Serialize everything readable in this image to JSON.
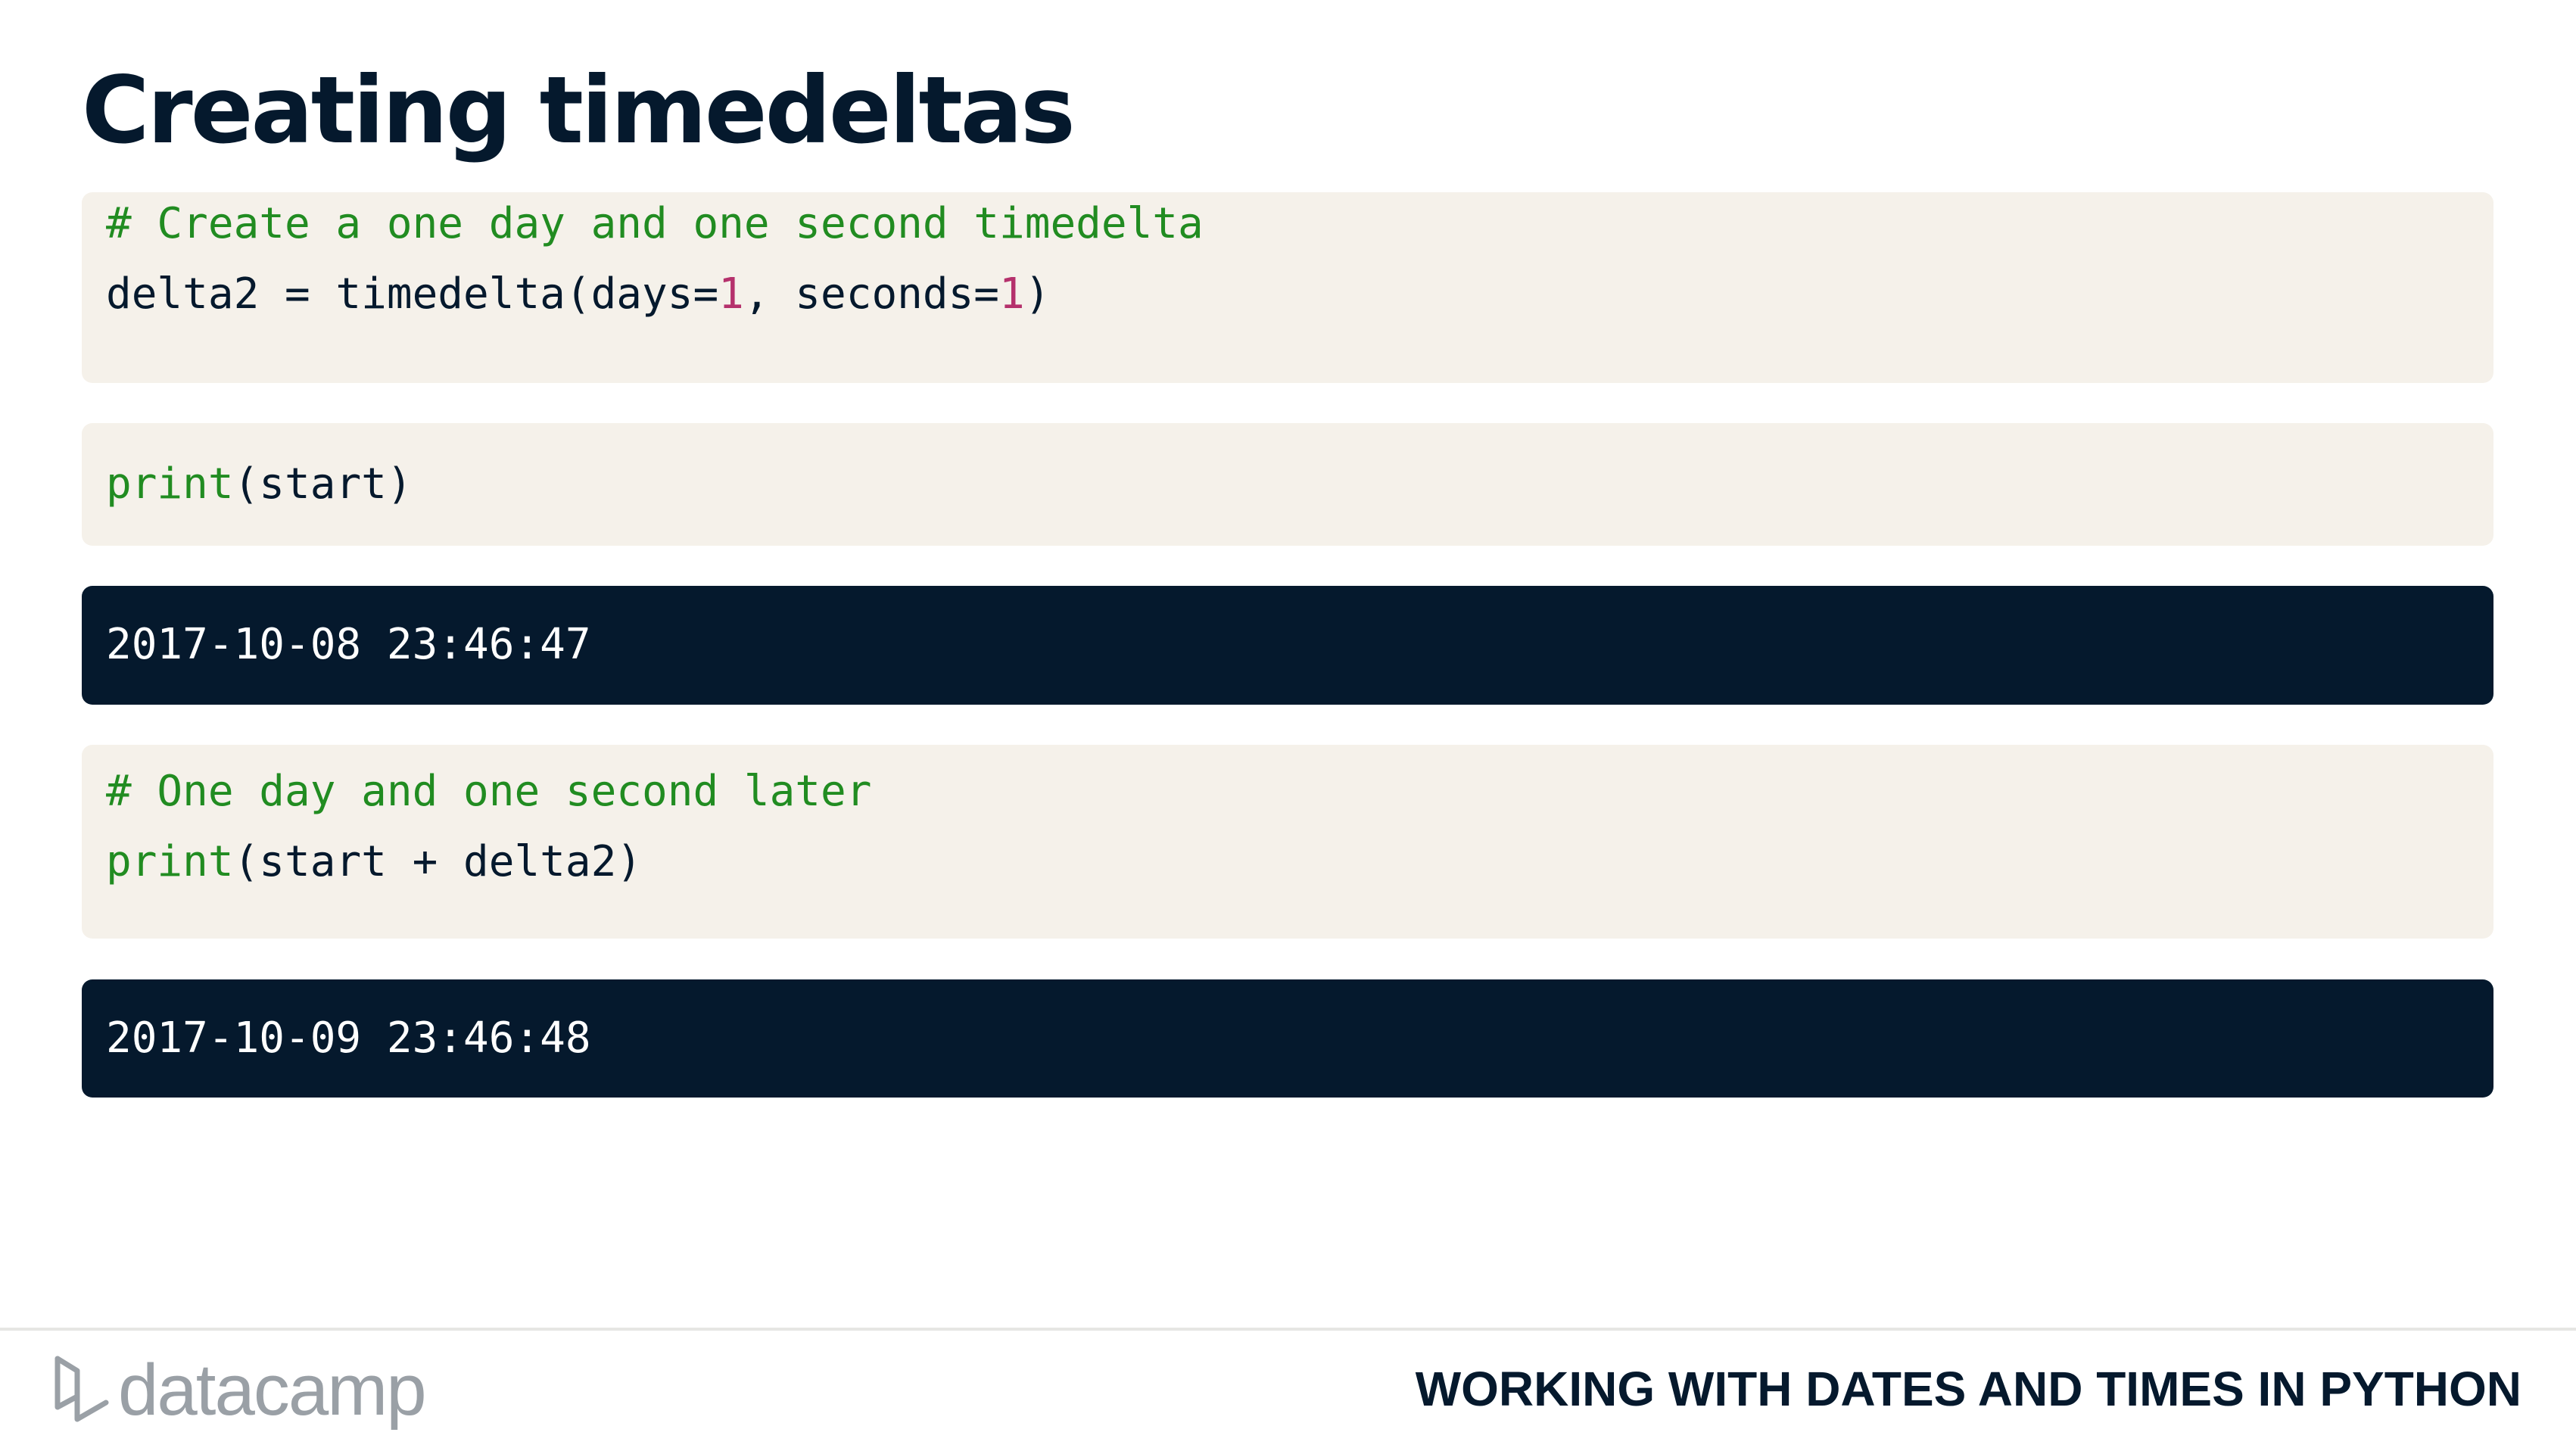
{
  "slide": {
    "title": "Creating timedeltas"
  },
  "code_blocks": [
    {
      "kind": "input",
      "lines": [
        [
          {
            "type": "comment",
            "text": "# Create a one day and one second timedelta"
          }
        ],
        [
          {
            "type": "plain",
            "text": "delta2 = timedelta(days="
          },
          {
            "type": "number",
            "text": "1"
          },
          {
            "type": "plain",
            "text": ", seconds="
          },
          {
            "type": "number",
            "text": "1"
          },
          {
            "type": "plain",
            "text": ")"
          }
        ]
      ]
    },
    {
      "kind": "input",
      "lines": [
        [
          {
            "type": "builtin",
            "text": "print"
          },
          {
            "type": "plain",
            "text": "(start)"
          }
        ]
      ]
    },
    {
      "kind": "output",
      "lines": [
        [
          {
            "type": "output",
            "text": "2017-10-08 23:46:47"
          }
        ]
      ]
    },
    {
      "kind": "input",
      "lines": [
        [
          {
            "type": "comment",
            "text": "# One day and one second later"
          }
        ],
        [
          {
            "type": "builtin",
            "text": "print"
          },
          {
            "type": "plain",
            "text": "(start + delta2)"
          }
        ]
      ]
    },
    {
      "kind": "output",
      "lines": [
        [
          {
            "type": "output",
            "text": "2017-10-09 23:46:48"
          }
        ]
      ]
    }
  ],
  "footer": {
    "logo_text": "datacamp",
    "logo_icon": "datacamp-logo-icon",
    "course_title": "WORKING WITH DATES AND TIMES IN PYTHON"
  },
  "colors": {
    "title": "#05192d",
    "input_background": "#f5f1ea",
    "output_background": "#05192d",
    "comment": "#218c21",
    "number": "#b5316c",
    "logo_gray": "#9aa0a6"
  }
}
